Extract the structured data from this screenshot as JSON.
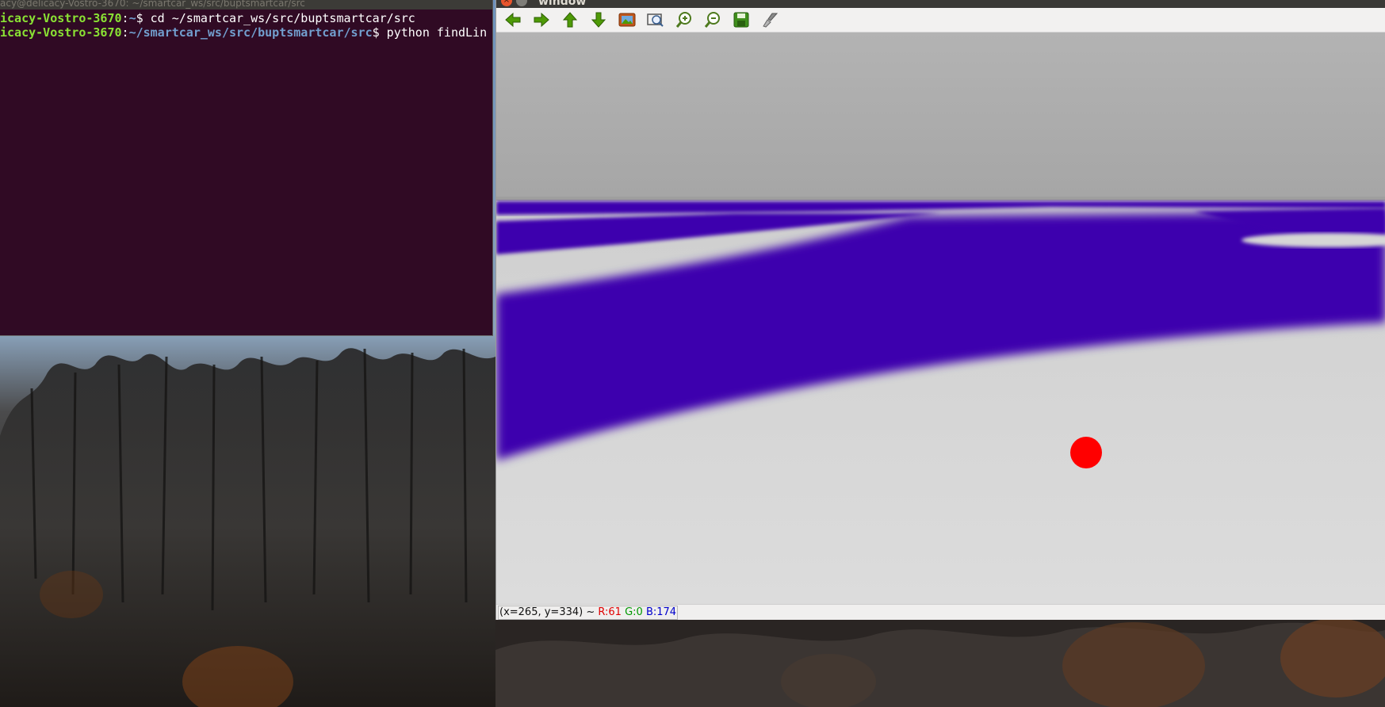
{
  "colors": {
    "terminal_bg": "#300a24",
    "terminal_user": "#8ae234",
    "terminal_path": "#729fcf",
    "lane_purple": "#3d00ae",
    "marker_red": "#ff0000"
  },
  "terminal": {
    "title": "acy@delicacy-Vostro-3670: ~/smartcar_ws/src/buptsmartcar/src",
    "lines": [
      {
        "user": "icacy-Vostro-3670",
        "path": "~",
        "command": "cd ~/smartcar_ws/src/buptsmartcar/src"
      },
      {
        "user": "icacy-Vostro-3670",
        "path": "~/smartcar_ws/src/buptsmartcar/src",
        "command": "python findLin"
      }
    ]
  },
  "viewer": {
    "title": "window",
    "close_glyph": "×",
    "toolbar": [
      {
        "name": "pan-left-button",
        "icon": "arrow-left-icon"
      },
      {
        "name": "pan-right-button",
        "icon": "arrow-right-icon"
      },
      {
        "name": "pan-up-button",
        "icon": "arrow-up-icon"
      },
      {
        "name": "pan-down-button",
        "icon": "arrow-down-icon"
      },
      {
        "name": "zoom-original-button",
        "icon": "image-icon"
      },
      {
        "name": "zoom-fit-button",
        "icon": "zoom-fit-icon"
      },
      {
        "name": "zoom-in-button",
        "icon": "zoom-in-icon"
      },
      {
        "name": "zoom-out-button",
        "icon": "zoom-out-icon"
      },
      {
        "name": "save-button",
        "icon": "save-icon"
      },
      {
        "name": "properties-button",
        "icon": "brush-icon"
      }
    ],
    "status": {
      "coords": "(x=265, y=334) ~",
      "r": "R:61",
      "g": "G:0",
      "b": "B:174"
    }
  }
}
